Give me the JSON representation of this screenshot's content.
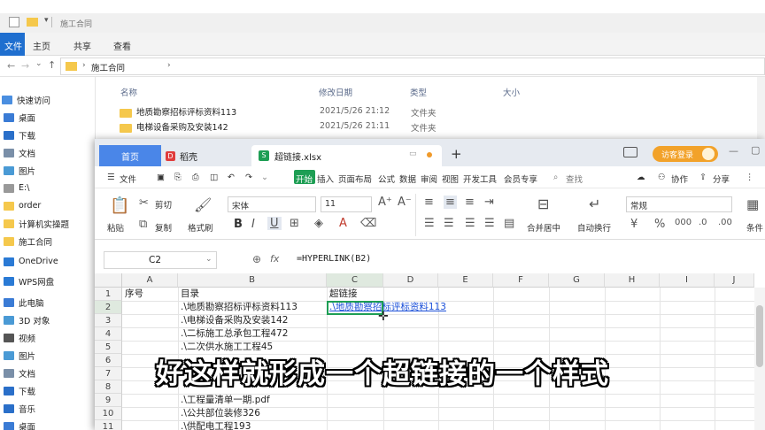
{
  "explorer": {
    "title": "施工合同",
    "ribbon_tabs": [
      "文件",
      "主页",
      "共享",
      "查看"
    ],
    "address_path": "施工合同",
    "nav_items": [
      {
        "label": "快速访问",
        "color": "#4a8ee0"
      },
      {
        "label": "桌面",
        "color": "#3a7bd5"
      },
      {
        "label": "下载",
        "color": "#2a6fc9"
      },
      {
        "label": "文档",
        "color": "#7a8fa8"
      },
      {
        "label": "图片",
        "color": "#4a9ad5"
      },
      {
        "label": "E:\\",
        "color": "#999999"
      },
      {
        "label": "order",
        "color": "#f5c84c"
      },
      {
        "label": "计算机实操题",
        "color": "#f5c84c"
      },
      {
        "label": "施工合同",
        "color": "#f5c84c"
      },
      {
        "label": "OneDrive",
        "color": "#2a7ad5"
      },
      {
        "label": "WPS网盘",
        "color": "#2a7ad5"
      },
      {
        "label": "此电脑",
        "color": "#3a7bd5"
      },
      {
        "label": "3D 对象",
        "color": "#4a9ad5"
      },
      {
        "label": "视频",
        "color": "#555555"
      },
      {
        "label": "图片",
        "color": "#4a9ad5"
      },
      {
        "label": "文档",
        "color": "#7a8fa8"
      },
      {
        "label": "下载",
        "color": "#2a6fc9"
      },
      {
        "label": "音乐",
        "color": "#2a6fc9"
      },
      {
        "label": "桌面",
        "color": "#3a7bd5"
      }
    ],
    "columns": {
      "name": "名称",
      "modified": "修改日期",
      "type": "类型",
      "size": "大小"
    },
    "files": [
      {
        "name": "地质勘察招标评标资料113",
        "modified": "2021/5/26 21:12",
        "type": "文件夹"
      },
      {
        "name": "电梯设备采购及安装142",
        "modified": "2021/5/26 21:11",
        "type": "文件夹"
      }
    ]
  },
  "wps": {
    "tabs": {
      "home": "首页",
      "daoke": "稻壳",
      "file": "超链接.xlsx",
      "add": "+"
    },
    "login_button": "访客登录",
    "menu": [
      "文件",
      "开始",
      "插入",
      "页面布局",
      "公式",
      "数据",
      "审阅",
      "视图",
      "开发工具",
      "会员专享"
    ],
    "menu_active": "开始",
    "search_label": "查找",
    "collab_label": "协作",
    "share_label": "分享",
    "ribbon": {
      "paste": "粘贴",
      "cut": "剪切",
      "copy": "复制",
      "format_painter": "格式刷",
      "font": "宋体",
      "font_size": "11",
      "merge_center": "合并居中",
      "wrap": "自动换行",
      "number_format": "常规",
      "condition": "条件"
    },
    "name_box": "C2",
    "formula": "=HYPERLINK(B2)",
    "grid": {
      "columns": [
        "A",
        "B",
        "C",
        "D",
        "E",
        "F",
        "G",
        "H",
        "I",
        "J"
      ],
      "rows": [
        {
          "n": "1",
          "a": "序号",
          "b": "目录",
          "c": "超链接"
        },
        {
          "n": "2",
          "a": "",
          "b": ".\\地质勘察招标评标资料113",
          "c": ".\\地质勘察招标评标资料113"
        },
        {
          "n": "3",
          "a": "",
          "b": ".\\电梯设备采购及安装142",
          "c": ""
        },
        {
          "n": "4",
          "a": "",
          "b": ".\\二标施工总承包工程472",
          "c": ""
        },
        {
          "n": "5",
          "a": "",
          "b": ".\\二次供水施工工程45",
          "c": ""
        },
        {
          "n": "6",
          "a": "",
          "b": "",
          "c": ""
        },
        {
          "n": "7",
          "a": "",
          "b": "",
          "c": ""
        },
        {
          "n": "8",
          "a": "",
          "b": "",
          "c": ""
        },
        {
          "n": "9",
          "a": "",
          "b": ".\\工程量清单一期.pdf",
          "c": ""
        },
        {
          "n": "10",
          "a": "",
          "b": ".\\公共部位装修326",
          "c": ""
        },
        {
          "n": "11",
          "a": "",
          "b": ".\\供配电工程193",
          "c": ""
        }
      ]
    }
  },
  "subtitle": "好这样就形成一个超链接的一个样式",
  "colors": {
    "accent_green": "#1e9e54",
    "wps_blue": "#4a86e8",
    "link": "#1a4fd8",
    "selected_header": "#dfe9df"
  }
}
